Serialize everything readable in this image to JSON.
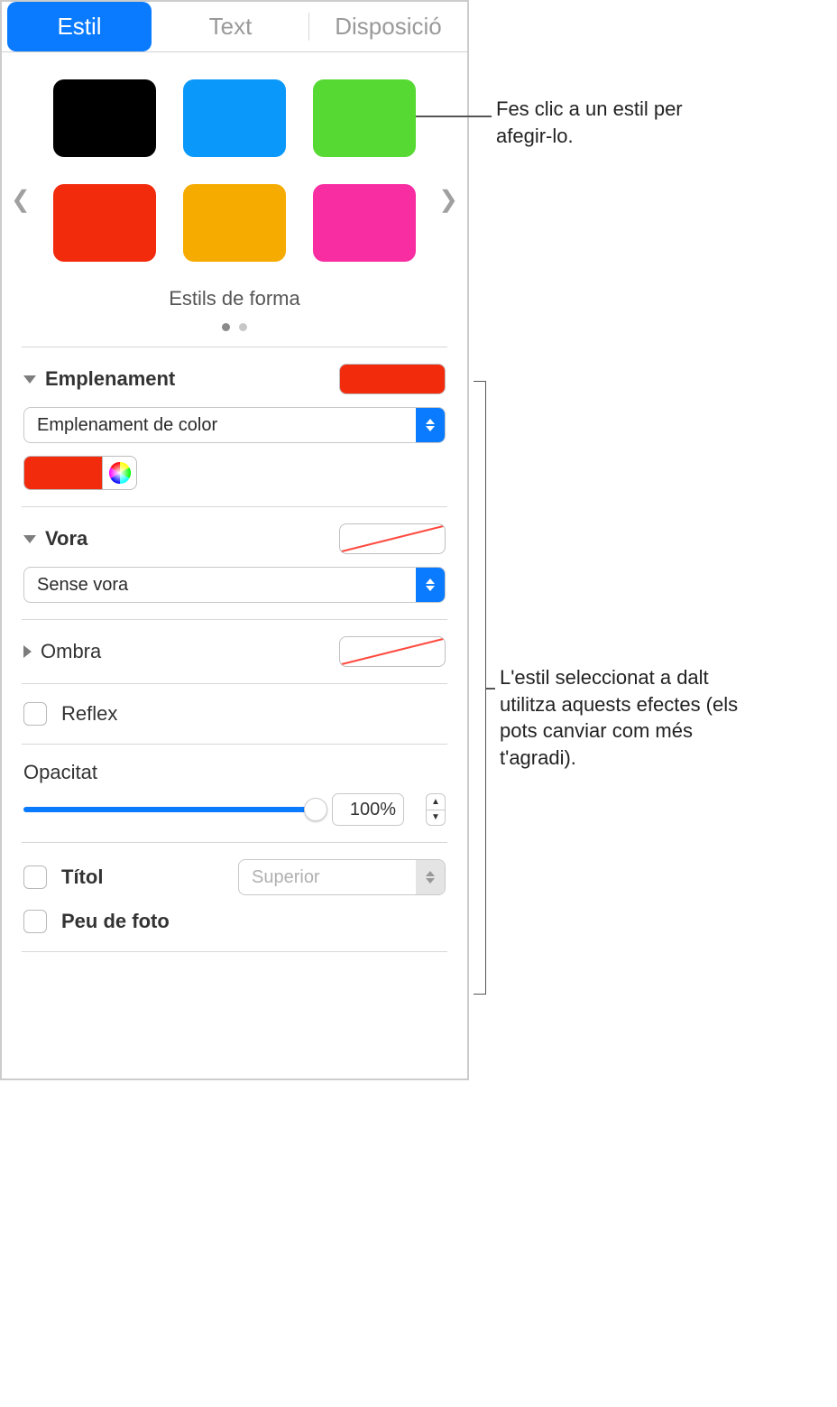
{
  "tabs": {
    "style": "Estil",
    "text": "Text",
    "layout": "Disposició",
    "active": "style"
  },
  "gallery": {
    "title": "Estils de forma",
    "swatches": [
      "#000000",
      "#0b98fb",
      "#57d933",
      "#f22b0d",
      "#f6ab00",
      "#f82da1"
    ]
  },
  "fill": {
    "title": "Emplenament",
    "previewColor": "#f22b0d",
    "popup": "Emplenament de color",
    "wellColor": "#f22b0d"
  },
  "border": {
    "title": "Vora",
    "popup": "Sense vora"
  },
  "shadow": {
    "title": "Ombra"
  },
  "reflection": {
    "title": "Reflex"
  },
  "opacity": {
    "title": "Opacitat",
    "value": "100%"
  },
  "titleOpt": {
    "label": "Títol",
    "posPopup": "Superior"
  },
  "caption": {
    "label": "Peu de foto"
  },
  "callouts": {
    "style": "Fes clic a un estil per afegir-lo.",
    "effects": "L'estil seleccionat a dalt utilitza aquests efectes (els pots canviar com més t'agradi)."
  }
}
